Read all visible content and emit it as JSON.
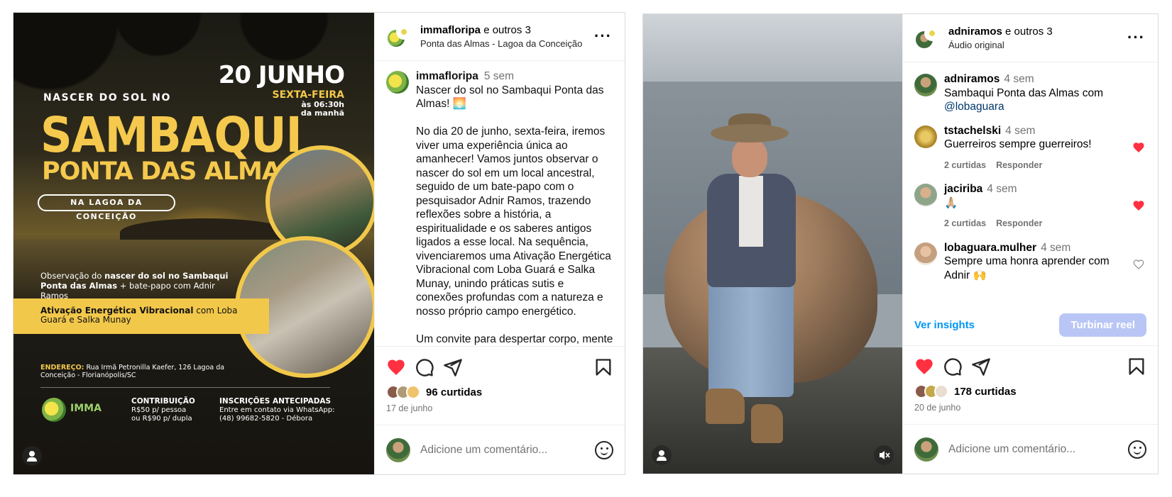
{
  "post1": {
    "header": {
      "username": "immafloripa",
      "collab_suffix": " e outros 3",
      "location": "Ponta das Almas - Lagoa da Conceição"
    },
    "caption": {
      "username": "immafloripa",
      "time": "5 sem",
      "text": "Nascer do sol no Sambaqui Ponta das Almas! 🌅\n\nNo dia 20 de junho, sexta-feira, iremos viver uma experiência única ao amanhecer! Vamos juntos observar o nascer do sol em um local ancestral, seguido de um bate-papo com o pesquisador Adnir Ramos, trazendo reflexões sobre a história, a espiritualidade e os saberes antigos ligados a esse local. Na sequência, vivenciaremos uma Ativação Energética Vibracional com Loba Guará e Salka Munay, unindo práticas sutis e conexões profundas com a natureza e nosso próprio campo energético.\n\nUm convite para despertar corpo, mente"
    },
    "likes": "96 curtidas",
    "date": "17 de junho",
    "comment_placeholder": "Adicione um comentário...",
    "poster": {
      "date": "20 JUNHO",
      "weekday": "SEXTA-FEIRA",
      "hour": "às 06:30h\nda manhã",
      "nascer": "NASCER DO SOL NO",
      "title1": "SAMBAQUI",
      "title2": "PONTA DAS ALMAS",
      "lagoa": "NA LAGOA DA CONCEIÇÃO",
      "obs_pre": "Observação do ",
      "obs_bold": "nascer do sol no Sambaqui Ponta das Almas",
      "obs_post": " + bate-papo com Adnir Ramos",
      "ativ_bold": "Ativação Energética Vibracional",
      "ativ_post": " com Loba Guará e Salka Munay",
      "addr_label": "ENDEREÇO:",
      "addr": " Rua Irmã Petronilla Kaefer, 126 Lagoa da Conceição - Florianópolis/SC",
      "logo_text": "IMMA",
      "contrib_title": "CONTRIBUIÇÃO",
      "contrib_text": "R$50 p/ pessoa\nou R$90 p/ dupla",
      "insc_title": "INSCRIÇÕES ANTECIPADAS",
      "insc_text": "Entre em contato via WhatsApp:\n(48) 99682-5820 - Débora"
    }
  },
  "post2": {
    "header": {
      "username": "adniramos",
      "collab_suffix": " e outros 3",
      "audio": "Áudio original"
    },
    "comments": [
      {
        "username": "adniramos",
        "time": "4 sem",
        "text": "Sambaqui Ponta das Almas com ",
        "mention": "@lobaguara",
        "likes": "",
        "reply": "",
        "liked": "none"
      },
      {
        "username": "tstachelski",
        "time": "4 sem",
        "text": "Guerreiros sempre guerreiros!",
        "mention": "",
        "likes": "2 curtidas",
        "reply": "Responder",
        "liked": "red"
      },
      {
        "username": "jaciriba",
        "time": "4 sem",
        "text": "🙏🏼",
        "mention": "",
        "likes": "2 curtidas",
        "reply": "Responder",
        "liked": "red"
      },
      {
        "username": "lobaguara.mulher",
        "time": "4 sem",
        "text": "Sempre uma honra aprender com Adnir 🙌",
        "mention": "",
        "likes": "",
        "reply": "",
        "liked": "outline"
      }
    ],
    "insights": "Ver insights",
    "boost": "Turbinar reel",
    "likes": "178 curtidas",
    "date": "20 de junho",
    "comment_placeholder": "Adicione um comentário..."
  },
  "colors": {
    "like_red": "#ff3040",
    "link_blue": "#0095f6",
    "poster_yellow": "#f2c84b"
  }
}
